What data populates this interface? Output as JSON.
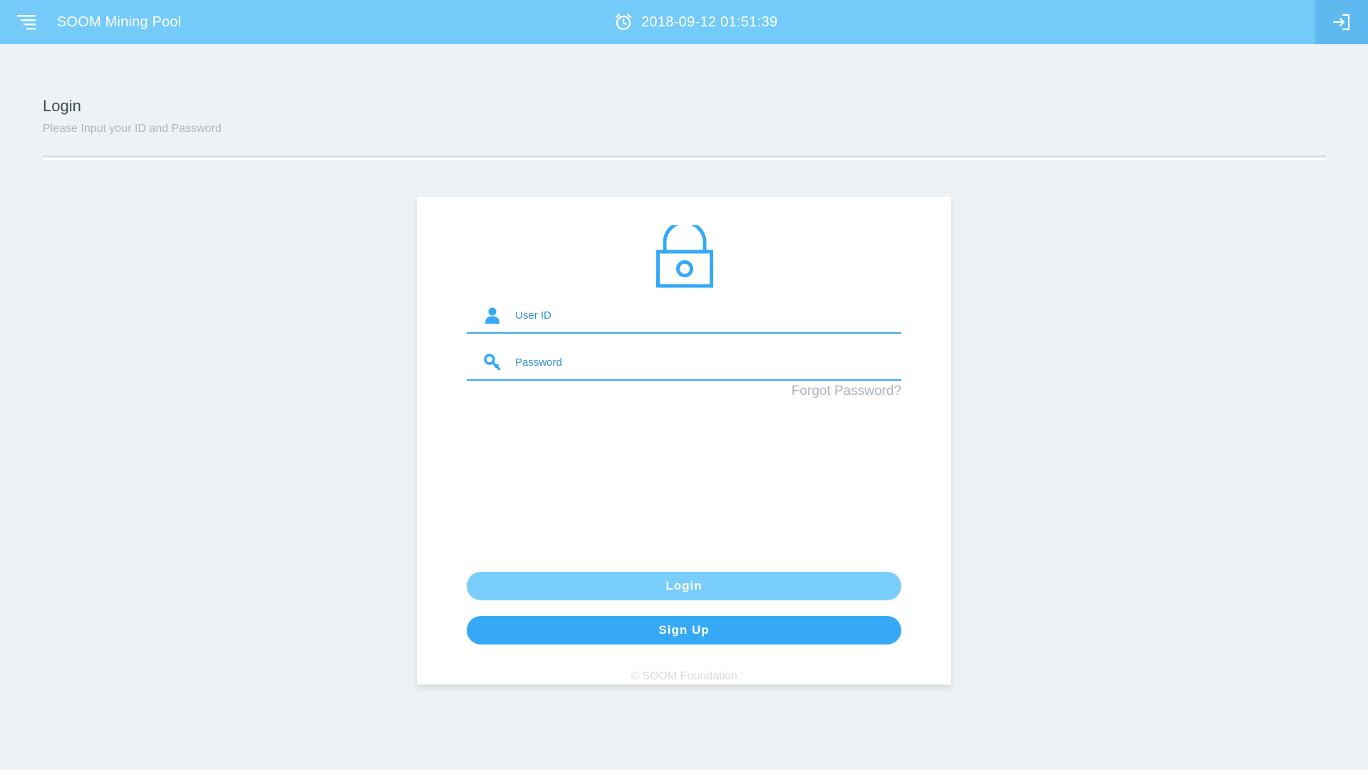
{
  "header": {
    "app_title": "SOOM Mining Pool",
    "datetime": "2018-09-12 01:51:39",
    "menu_icon": "menu-icon",
    "clock_icon": "alarm-clock-icon",
    "signin_icon": "sign-in-icon"
  },
  "page": {
    "title": "Login",
    "subtitle": "Please Input your ID and Password"
  },
  "login_form": {
    "lock_icon": "lock-icon",
    "user_id": {
      "icon": "user-icon",
      "placeholder": "User ID",
      "value": ""
    },
    "password": {
      "icon": "key-icon",
      "placeholder": "Password",
      "value": ""
    },
    "forgot_label": "Forgot Password?",
    "login_label": "Login",
    "signup_label": "Sign Up",
    "copyright": "© SOOM Foundation"
  },
  "colors": {
    "header_bg": "#74cbf9",
    "accent": "#35a9f6",
    "login_button": "#79cdfb",
    "page_bg": "#eef2f5"
  }
}
